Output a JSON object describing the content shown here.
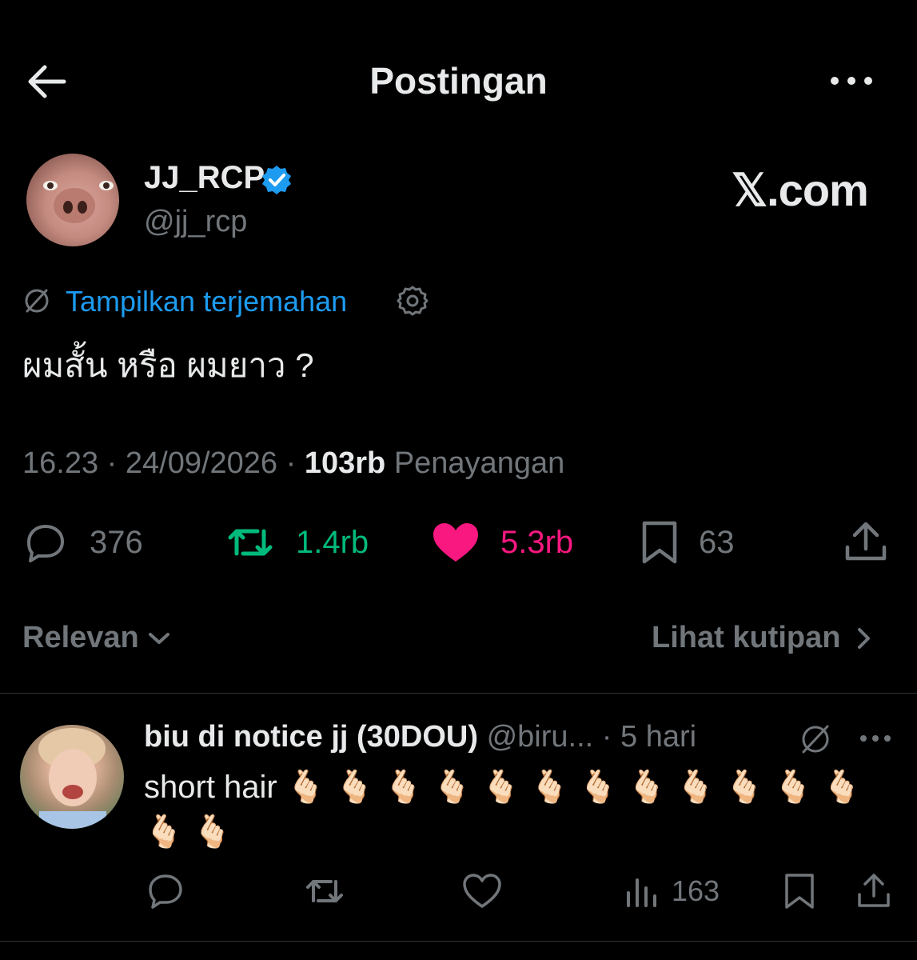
{
  "header": {
    "title": "Postingan"
  },
  "post": {
    "author": {
      "display_name": "JJ_RCP",
      "handle": "@jj_rcp"
    },
    "brand": "𝕏.com",
    "translate_label": "Tampilkan terjemahan",
    "text": "ผมสั้น หรือ ผมยาว ?",
    "time": "16.23",
    "date": "24/09/2026",
    "views_count": "103rb",
    "views_label": "Penayangan",
    "stats": {
      "replies": "376",
      "reposts": "1.4rb",
      "likes": "5.3rb",
      "bookmarks": "63"
    }
  },
  "sort": {
    "label": "Relevan",
    "quotes_label": "Lihat kutipan"
  },
  "reply": {
    "display_name": "biu di notice jj (30DOU)",
    "handle": "@biru...",
    "age": "5 hari",
    "text": "short hair 🫰🏻 🫰🏻 🫰🏻 🫰🏻 🫰🏻 🫰🏻 🫰🏻 🫰🏻 🫰🏻 🫰🏻 🫰🏻 🫰🏻 🫰🏻 🫰🏻",
    "views": "163"
  },
  "colors": {
    "accent": "#1d9bf0",
    "repost": "#00ba7c",
    "like": "#f91880",
    "muted": "#71767b"
  },
  "icons": [
    "back-arrow-icon",
    "more-icon",
    "verified-badge-icon",
    "globe-icon",
    "gear-icon",
    "reply-icon",
    "repost-icon",
    "heart-icon",
    "bookmark-icon",
    "share-icon",
    "chevron-down-icon",
    "chevron-right-icon",
    "views-icon"
  ]
}
